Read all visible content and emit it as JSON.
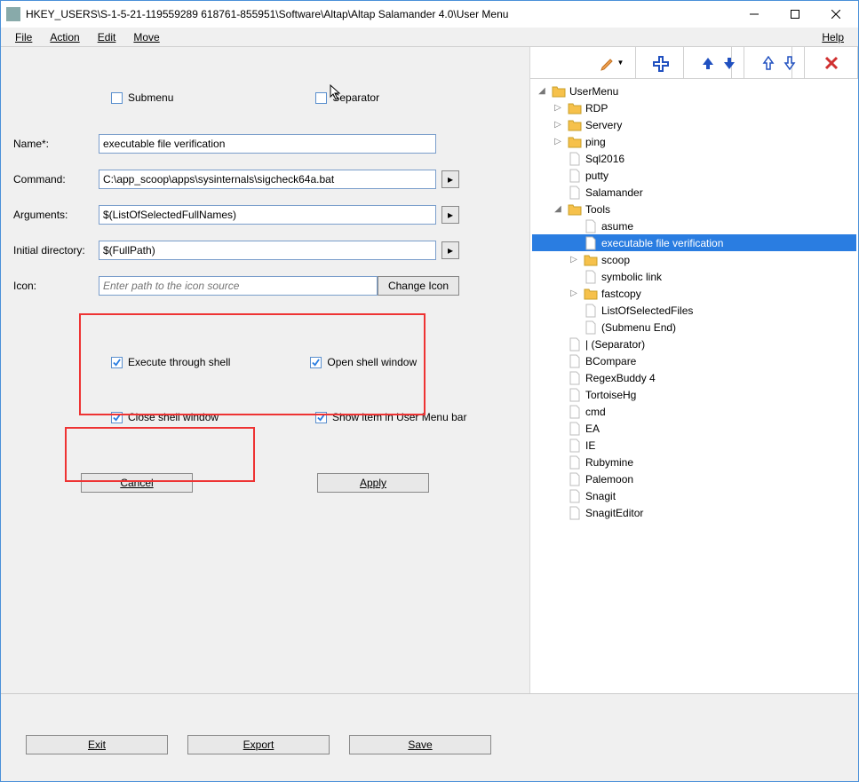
{
  "window": {
    "title": "HKEY_USERS\\S-1-5-21-119559289              618761-855951\\Software\\Altap\\Altap Salamander 4.0\\User Menu"
  },
  "menu": {
    "file": "File",
    "action": "Action",
    "edit": "Edit",
    "move": "Move",
    "help": "Help"
  },
  "form": {
    "submenu_label": "Submenu",
    "separator_label": "Separator",
    "name_label": "Name*:",
    "name_value": "executable file verification",
    "command_label": "Command:",
    "command_value": "C:\\app_scoop\\apps\\sysinternals\\sigcheck64a.bat",
    "arguments_label": "Arguments:",
    "arguments_value": "$(ListOfSelectedFullNames)",
    "initdir_label": "Initial directory:",
    "initdir_value": "$(FullPath)",
    "icon_label": "Icon:",
    "icon_placeholder": "Enter path to the icon source",
    "change_icon": "Change Icon",
    "exec_shell": "Execute through shell",
    "open_shell": "Open shell window",
    "close_shell": "Close shell window",
    "show_menubar": "Show item in User Menu bar",
    "cancel": "Cancel",
    "apply": "Apply",
    "exit": "Exit",
    "export": "Export",
    "save": "Save"
  },
  "tree": [
    {
      "depth": 0,
      "exp": "▾",
      "type": "folder",
      "label": "UserMenu"
    },
    {
      "depth": 1,
      "exp": "▸",
      "type": "folder",
      "label": "RDP"
    },
    {
      "depth": 1,
      "exp": "▸",
      "type": "folder",
      "label": "Servery"
    },
    {
      "depth": 1,
      "exp": "▸",
      "type": "folder",
      "label": "ping"
    },
    {
      "depth": 1,
      "exp": "",
      "type": "file",
      "label": "Sql2016"
    },
    {
      "depth": 1,
      "exp": "",
      "type": "file",
      "label": "putty"
    },
    {
      "depth": 1,
      "exp": "",
      "type": "file",
      "label": "Salamander"
    },
    {
      "depth": 1,
      "exp": "▾",
      "type": "folder",
      "label": "Tools"
    },
    {
      "depth": 2,
      "exp": "",
      "type": "file",
      "label": "asume"
    },
    {
      "depth": 2,
      "exp": "",
      "type": "file",
      "label": "executable file verification",
      "selected": true
    },
    {
      "depth": 2,
      "exp": "▸",
      "type": "folder",
      "label": "scoop"
    },
    {
      "depth": 2,
      "exp": "",
      "type": "file",
      "label": "symbolic link"
    },
    {
      "depth": 2,
      "exp": "▸",
      "type": "folder",
      "label": "fastcopy"
    },
    {
      "depth": 2,
      "exp": "",
      "type": "file",
      "label": "ListOfSelectedFiles"
    },
    {
      "depth": 2,
      "exp": "",
      "type": "file",
      "label": "(Submenu End)"
    },
    {
      "depth": 1,
      "exp": "",
      "type": "file",
      "label": "| (Separator)"
    },
    {
      "depth": 1,
      "exp": "",
      "type": "file",
      "label": "BCompare"
    },
    {
      "depth": 1,
      "exp": "",
      "type": "file",
      "label": "RegexBuddy 4"
    },
    {
      "depth": 1,
      "exp": "",
      "type": "file",
      "label": "TortoiseHg"
    },
    {
      "depth": 1,
      "exp": "",
      "type": "file",
      "label": "cmd"
    },
    {
      "depth": 1,
      "exp": "",
      "type": "file",
      "label": "EA"
    },
    {
      "depth": 1,
      "exp": "",
      "type": "file",
      "label": "IE"
    },
    {
      "depth": 1,
      "exp": "",
      "type": "file",
      "label": "Rubymine"
    },
    {
      "depth": 1,
      "exp": "",
      "type": "file",
      "label": "Palemoon"
    },
    {
      "depth": 1,
      "exp": "",
      "type": "file",
      "label": "Snagit"
    },
    {
      "depth": 1,
      "exp": "",
      "type": "file",
      "label": "SnagitEditor"
    }
  ]
}
